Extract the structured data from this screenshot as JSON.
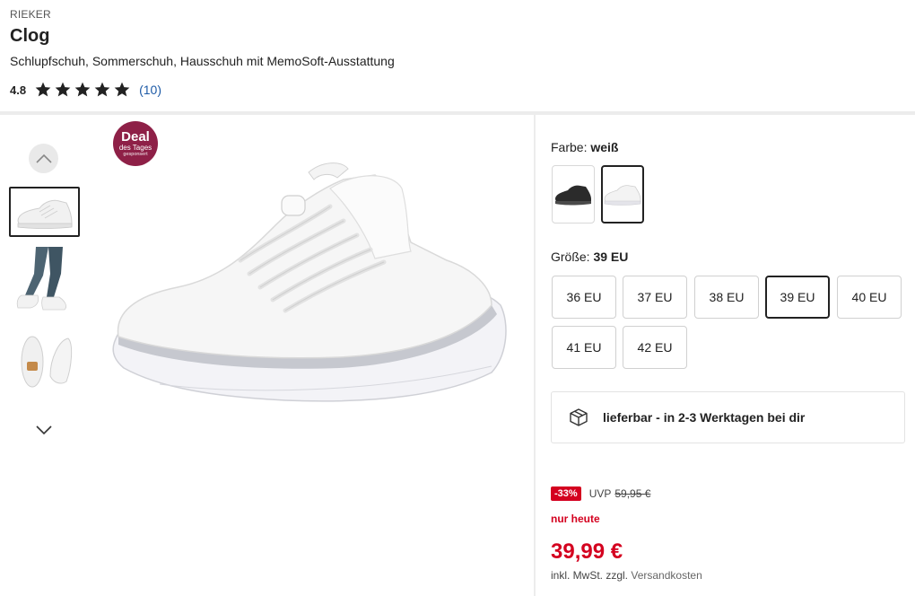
{
  "product": {
    "brand": "RIEKER",
    "title": "Clog",
    "subtitle": "Schlupfschuh, Sommerschuh, Hausschuh mit MemoSoft-Ausstattung",
    "rating": {
      "score": "4.8",
      "stars": 5,
      "count": "(10)"
    }
  },
  "gallery": {
    "badge": {
      "line1": "Deal",
      "line2": "des Tages",
      "line3": "gesponsert",
      "color": "#8e2047"
    },
    "thumbnails": [
      "white-clog-side",
      "model-wearing-clog",
      "clog-pair-top"
    ],
    "active_index": 0
  },
  "color": {
    "label": "Farbe:",
    "selected": "weiß",
    "options": [
      "schwarz",
      "weiß"
    ]
  },
  "size": {
    "label": "Größe:",
    "selected": "39 EU",
    "options": [
      "36 EU",
      "37 EU",
      "38 EU",
      "39 EU",
      "40 EU",
      "41 EU",
      "42 EU"
    ]
  },
  "delivery": {
    "text": "lieferbar - in 2-3 Werktagen bei dir"
  },
  "pricing": {
    "discount": "-33%",
    "uvp_label": "UVP",
    "uvp_price": "59,95 €",
    "today": "nur heute",
    "price": "39,99 €",
    "tax_prefix": "inkl. MwSt. zzgl.",
    "tax_link": "Versandkosten",
    "accent": "#d4001f"
  }
}
